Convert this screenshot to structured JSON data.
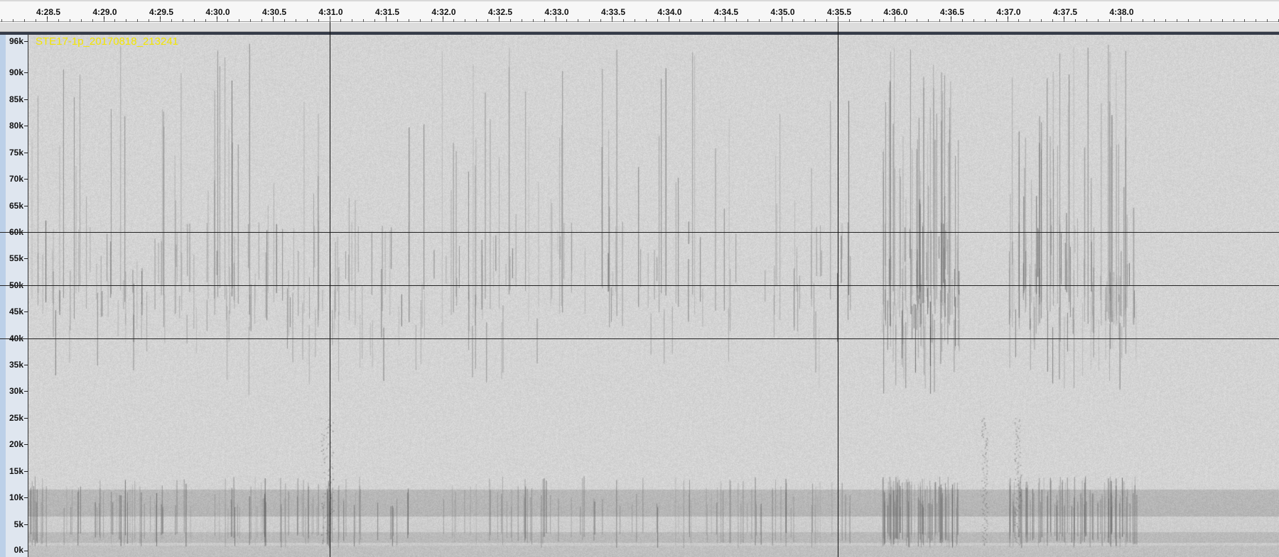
{
  "ruler": {
    "labels": [
      "4:28.5",
      "4:29.0",
      "4:29.5",
      "4:30.0",
      "4:30.5",
      "4:31.0",
      "4:31.5",
      "4:32.0",
      "4:32.5",
      "4:33.0",
      "4:33.5",
      "4:34.0",
      "4:34.5",
      "4:35.0",
      "4:35.5",
      "4:36.0",
      "4:36.5",
      "4:37.0",
      "4:37.5",
      "4:38.0"
    ],
    "first_time_s": 268.5,
    "step_s": 0.5
  },
  "track": {
    "name": "STE17-1p_20170818_213241"
  },
  "frequency_axis": {
    "labels": [
      "96k",
      "90k",
      "85k",
      "80k",
      "75k",
      "70k",
      "65k",
      "60k",
      "55k",
      "50k",
      "45k",
      "40k",
      "35k",
      "30k",
      "25k",
      "20k",
      "15k",
      "10k",
      "5k",
      "0k"
    ],
    "values_hz": [
      96000,
      90000,
      85000,
      80000,
      75000,
      70000,
      65000,
      60000,
      55000,
      50000,
      45000,
      40000,
      35000,
      30000,
      25000,
      20000,
      15000,
      10000,
      5000,
      0
    ],
    "max_hz": 96000
  },
  "guides": {
    "horizontal_hz": [
      60000,
      50000,
      40000
    ],
    "cursor_times_s": [
      271.0,
      275.5
    ]
  },
  "colors": {
    "spectrogram_bg": "#d4d4d4",
    "track_name": "#f3e600",
    "axis_panel": "#dfe6ef",
    "guide_line": "#222222"
  }
}
